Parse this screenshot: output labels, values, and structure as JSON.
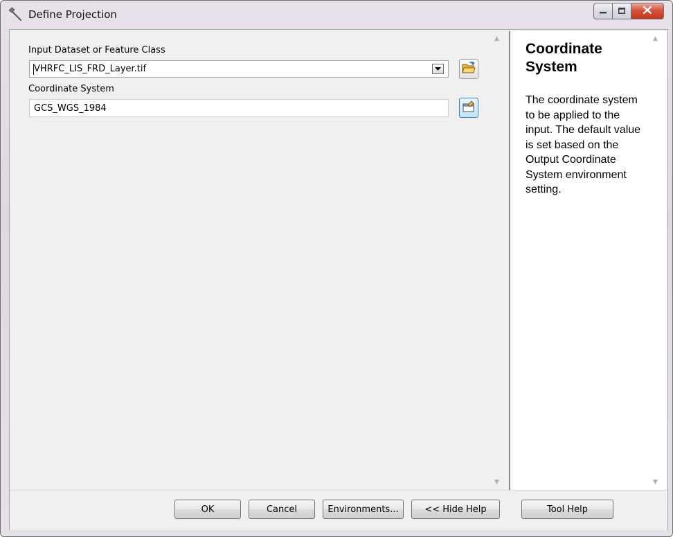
{
  "window": {
    "title": "Define Projection",
    "colors": {
      "title_bg": "#e3dbe6",
      "close_btn": "#c8432c",
      "help_bg": "#ffffff"
    }
  },
  "form": {
    "input_label": "Input Dataset or Feature Class",
    "input_value": "VHRFC_LIS_FRD_Layer.tif",
    "coord_label": "Coordinate System",
    "coord_value": "GCS_WGS_1984",
    "input_browse_icon": "open-folder-icon",
    "coord_properties_icon": "spatial-reference-properties-icon"
  },
  "help": {
    "title": "Coordinate System",
    "body": "The coordinate system to be applied to the input. The default value is set based on the Output Coordinate System environment setting."
  },
  "buttons": {
    "ok": "OK",
    "cancel": "Cancel",
    "environments": "Environments...",
    "hide_help": "<< Hide Help",
    "tool_help": "Tool Help"
  }
}
